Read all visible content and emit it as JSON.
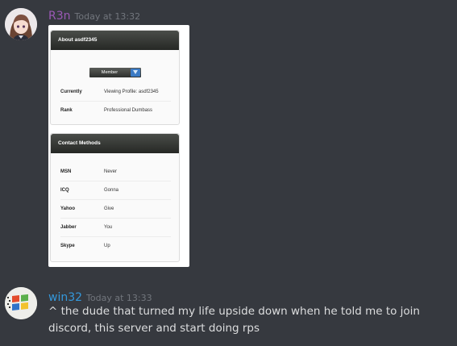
{
  "messages": [
    {
      "author": "R3n",
      "author_color": "#9b59b6",
      "timestamp": "Today at 13:32",
      "attachment": {
        "about_panel": {
          "title": "About asdf2345",
          "badge_label": "Member",
          "rows": [
            {
              "key": "Currently",
              "value": "Viewing Profile: asdf2345"
            },
            {
              "key": "Rank",
              "value": "Professional Dumbass"
            }
          ]
        },
        "contact_panel": {
          "title": "Contact Methods",
          "rows": [
            {
              "key": "MSN",
              "value": "Never"
            },
            {
              "key": "ICQ",
              "value": "Gonna"
            },
            {
              "key": "Yahoo",
              "value": "Give"
            },
            {
              "key": "Jabber",
              "value": "You"
            },
            {
              "key": "Skype",
              "value": "Up"
            }
          ]
        }
      }
    },
    {
      "author": "win32",
      "author_color": "#3498db",
      "timestamp": "Today at 13:33",
      "text": "^ the dude that turned my life upside down when he told me to join discord, this server and start doing rps"
    }
  ]
}
